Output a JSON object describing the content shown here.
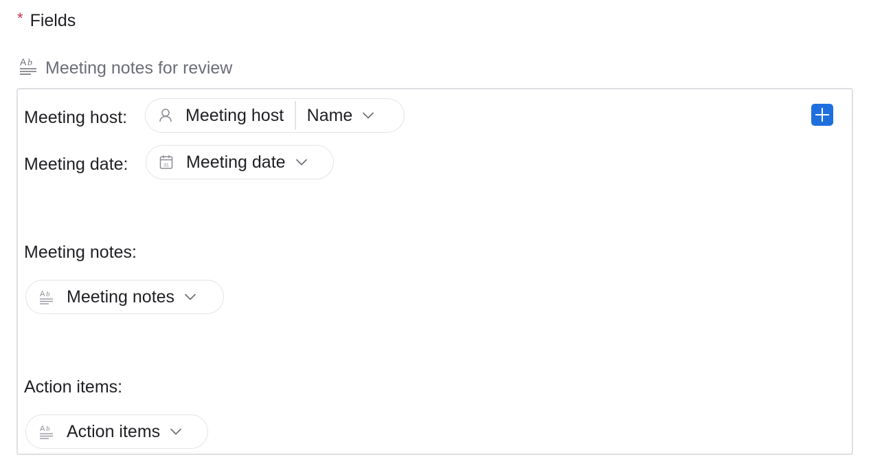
{
  "section": {
    "required_mark": "*",
    "title": "Fields"
  },
  "field": {
    "label": "Meeting notes for review",
    "icon": "text-field-icon"
  },
  "rows": {
    "host": {
      "label": "Meeting host:",
      "chip_label": "Meeting host",
      "chip_icon": "person-icon",
      "property": "Name"
    },
    "date": {
      "label": "Meeting date:",
      "chip_label": "Meeting date",
      "chip_icon": "calendar-icon",
      "calendar_day": "31"
    },
    "notes": {
      "label": "Meeting notes:",
      "chip_label": "Meeting notes",
      "chip_icon": "text-field-icon"
    },
    "actions": {
      "label": "Action items:",
      "chip_label": "Action items",
      "chip_icon": "text-field-icon"
    }
  },
  "add_button": {
    "icon": "plus-icon"
  },
  "colors": {
    "accent": "#1f6fde",
    "required": "#c4314b",
    "muted_text": "#6c6e77",
    "border": "#dedfe3"
  }
}
